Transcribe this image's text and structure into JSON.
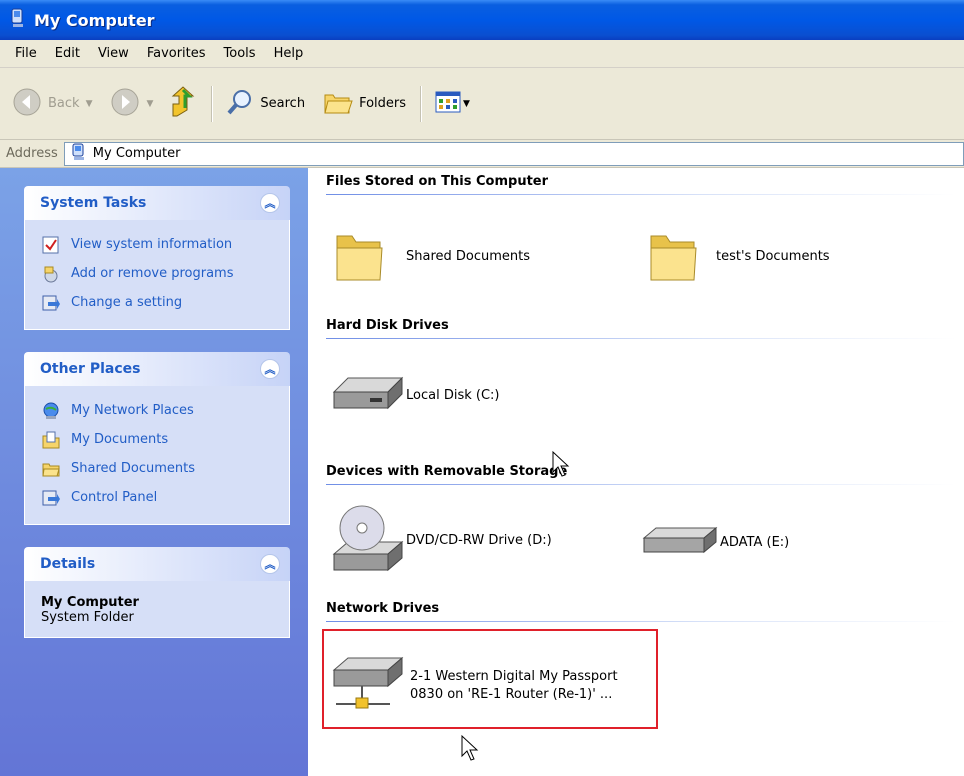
{
  "window": {
    "title": "My Computer"
  },
  "menu": [
    "File",
    "Edit",
    "View",
    "Favorites",
    "Tools",
    "Help"
  ],
  "toolbar": {
    "back": "Back",
    "search": "Search",
    "folders": "Folders"
  },
  "address": {
    "label": "Address",
    "value": "My Computer"
  },
  "sidebar": {
    "system_tasks": {
      "title": "System Tasks",
      "items": [
        "View system information",
        "Add or remove programs",
        "Change a setting"
      ]
    },
    "other_places": {
      "title": "Other Places",
      "items": [
        "My Network Places",
        "My Documents",
        "Shared Documents",
        "Control Panel"
      ]
    },
    "details": {
      "title": "Details",
      "name": "My Computer",
      "type": "System Folder"
    }
  },
  "groups": {
    "files": {
      "title": "Files Stored on This Computer",
      "items": [
        "Shared Documents",
        "test's Documents"
      ]
    },
    "hdd": {
      "title": "Hard Disk Drives",
      "items": [
        "Local Disk (C:)"
      ]
    },
    "removable": {
      "title": "Devices with Removable Storage",
      "items": [
        "DVD/CD-RW Drive (D:)",
        "ADATA (E:)"
      ]
    },
    "network": {
      "title": "Network Drives",
      "item_line1": "2-1 Western Digital My Passport",
      "item_line2": "0830 on 'RE-1 Router (Re-1)' ..."
    }
  },
  "colors": {
    "titlebar": "#0058e6",
    "link": "#215dc6",
    "highlight": "#e0202a"
  }
}
